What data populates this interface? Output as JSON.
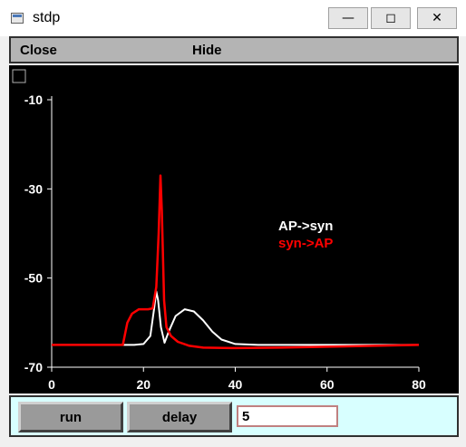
{
  "window": {
    "title": "stdp"
  },
  "menu": {
    "close_label": "Close",
    "hide_label": "Hide"
  },
  "icons": {
    "minimize": "minimize-icon",
    "maximize": "maximize-icon",
    "close": "close-icon",
    "app": "app-icon"
  },
  "controls": {
    "run_label": "run",
    "delay_label": "delay",
    "delay_value": "5"
  },
  "chart_data": {
    "type": "line",
    "xlim": [
      0,
      80
    ],
    "ylim": [
      -70,
      -10
    ],
    "x_ticks": [
      0,
      20,
      40,
      60,
      80
    ],
    "y_ticks": [
      -10,
      -30,
      -50,
      -70
    ],
    "grid": false,
    "legend_position": "right",
    "series": [
      {
        "name": "AP->syn",
        "color": "#ffffff",
        "points": [
          [
            0,
            -65
          ],
          [
            15.5,
            -65
          ],
          [
            16,
            -65
          ],
          [
            18,
            -65
          ],
          [
            20,
            -64.8
          ],
          [
            21.5,
            -63
          ],
          [
            22.3,
            -57
          ],
          [
            22.8,
            -53
          ],
          [
            23.2,
            -55
          ],
          [
            23.8,
            -61
          ],
          [
            24.6,
            -64.5
          ],
          [
            25.5,
            -62
          ],
          [
            27,
            -58.5
          ],
          [
            29,
            -57
          ],
          [
            31,
            -57.5
          ],
          [
            33,
            -59.5
          ],
          [
            35,
            -62
          ],
          [
            37,
            -63.8
          ],
          [
            40,
            -64.8
          ],
          [
            45,
            -65
          ],
          [
            80,
            -65
          ]
        ]
      },
      {
        "name": "syn->AP",
        "color": "#ff0000",
        "points": [
          [
            0,
            -65
          ],
          [
            15.5,
            -65
          ],
          [
            16.5,
            -60
          ],
          [
            17.5,
            -58
          ],
          [
            19,
            -57
          ],
          [
            21,
            -57
          ],
          [
            22,
            -56.8
          ],
          [
            22.8,
            -52
          ],
          [
            23.3,
            -40
          ],
          [
            23.7,
            -27
          ],
          [
            24,
            -35
          ],
          [
            24.5,
            -55
          ],
          [
            25,
            -61
          ],
          [
            26,
            -63
          ],
          [
            27.5,
            -64.3
          ],
          [
            30,
            -65.2
          ],
          [
            33,
            -65.6
          ],
          [
            40,
            -65.7
          ],
          [
            50,
            -65.6
          ],
          [
            60,
            -65.4
          ],
          [
            70,
            -65.2
          ],
          [
            80,
            -65
          ]
        ]
      }
    ]
  }
}
